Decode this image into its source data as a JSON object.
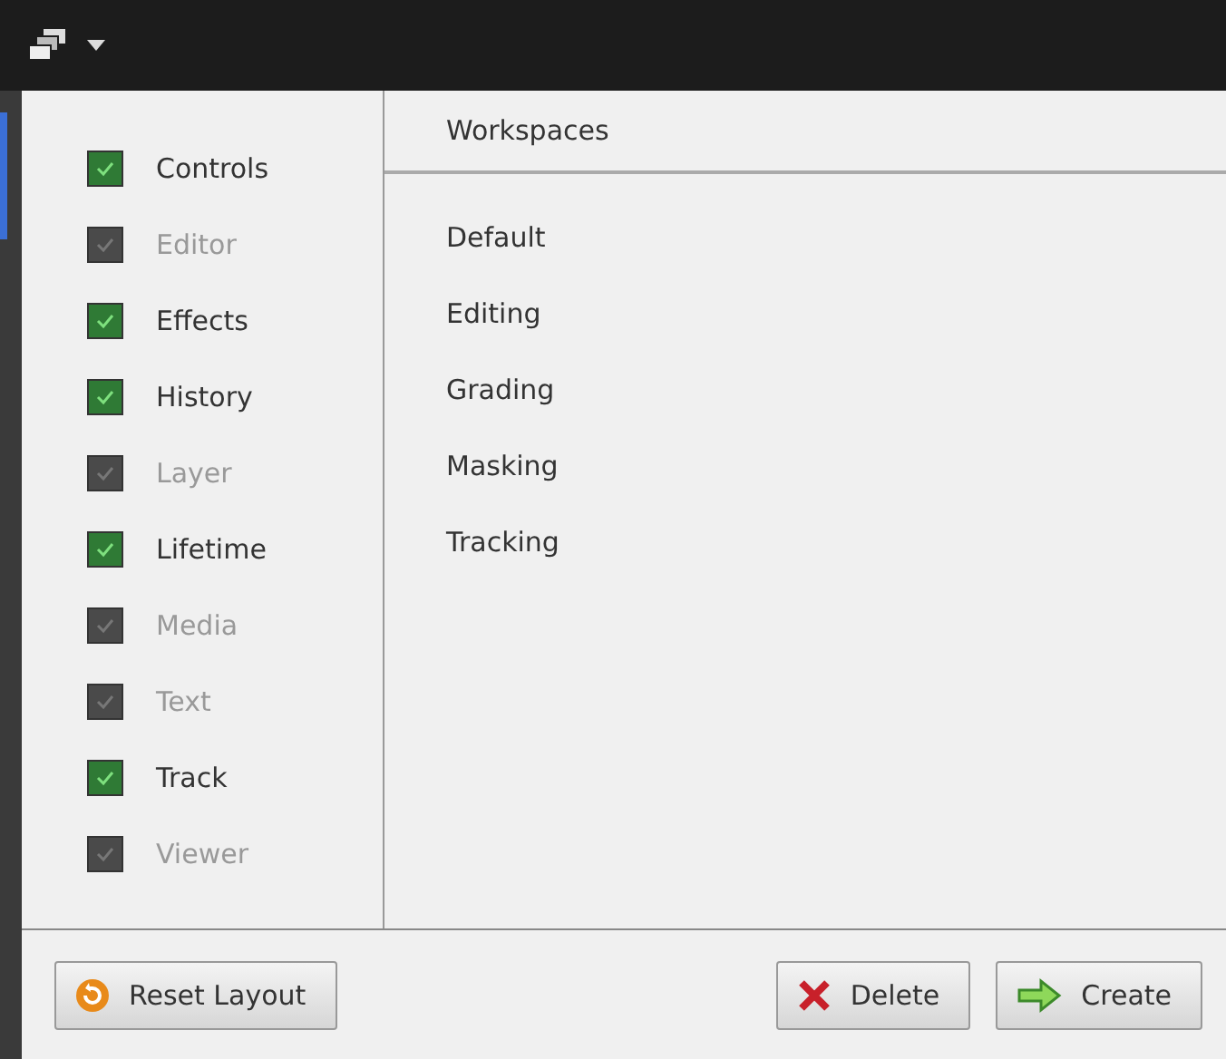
{
  "panels": [
    {
      "label": "Controls",
      "checked": true
    },
    {
      "label": "Editor",
      "checked": false
    },
    {
      "label": "Effects",
      "checked": true
    },
    {
      "label": "History",
      "checked": true
    },
    {
      "label": "Layer",
      "checked": false
    },
    {
      "label": "Lifetime",
      "checked": true
    },
    {
      "label": "Media",
      "checked": false
    },
    {
      "label": "Text",
      "checked": false
    },
    {
      "label": "Track",
      "checked": true
    },
    {
      "label": "Viewer",
      "checked": false
    }
  ],
  "workspaces": {
    "title": "Workspaces",
    "items": [
      "Default",
      "Editing",
      "Grading",
      "Masking",
      "Tracking"
    ]
  },
  "buttons": [
    {
      "kind": "reset",
      "label": "Reset Layout"
    },
    {
      "kind": "delete",
      "label": "Delete"
    },
    {
      "kind": "create",
      "label": "Create"
    }
  ]
}
